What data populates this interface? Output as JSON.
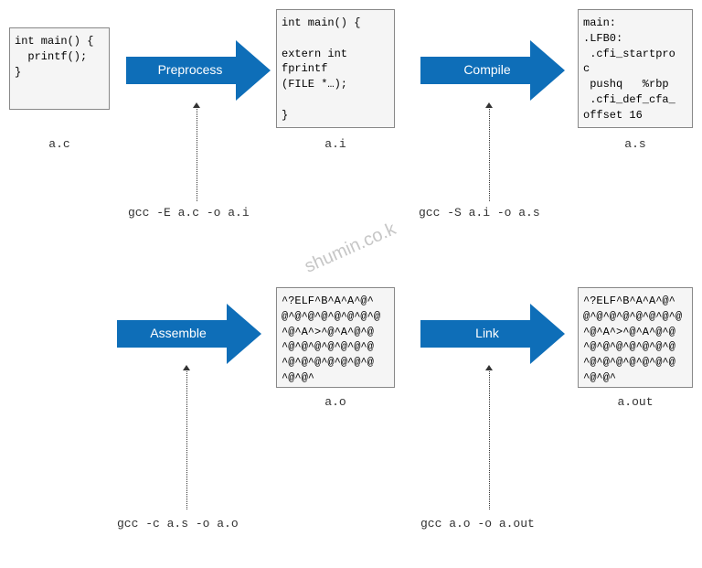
{
  "files": {
    "ac": {
      "label": "a.c",
      "content": "int main() {\n  printf();\n}"
    },
    "ai": {
      "label": "a.i",
      "content": "int main() {\n\nextern int\nfprintf\n(FILE *…);\n\n}"
    },
    "as": {
      "label": "a.s",
      "content": "main:\n.LFB0:\n .cfi_startpro\nc\n pushq   %rbp\n .cfi_def_cfa_\noffset 16"
    },
    "ao": {
      "label": "a.o",
      "content": "^?ELF^B^A^A^@^\n@^@^@^@^@^@^@^@\n^@^A^>^@^A^@^@\n^@^@^@^@^@^@^@\n^@^@^@^@^@^@^@\n^@^@^"
    },
    "aout": {
      "label": "a.out",
      "content": "^?ELF^B^A^A^@^\n@^@^@^@^@^@^@^@\n^@^A^>^@^A^@^@\n^@^@^@^@^@^@^@\n^@^@^@^@^@^@^@\n^@^@^"
    }
  },
  "steps": {
    "preprocess": {
      "label": "Preprocess",
      "cmd": "gcc -E a.c -o a.i"
    },
    "compile": {
      "label": "Compile",
      "cmd": "gcc -S a.i -o a.s"
    },
    "assemble": {
      "label": "Assemble",
      "cmd": "gcc -c a.s -o a.o"
    },
    "link": {
      "label": "Link",
      "cmd": "gcc a.o -o a.out"
    }
  },
  "watermark": "shumin.co.k"
}
